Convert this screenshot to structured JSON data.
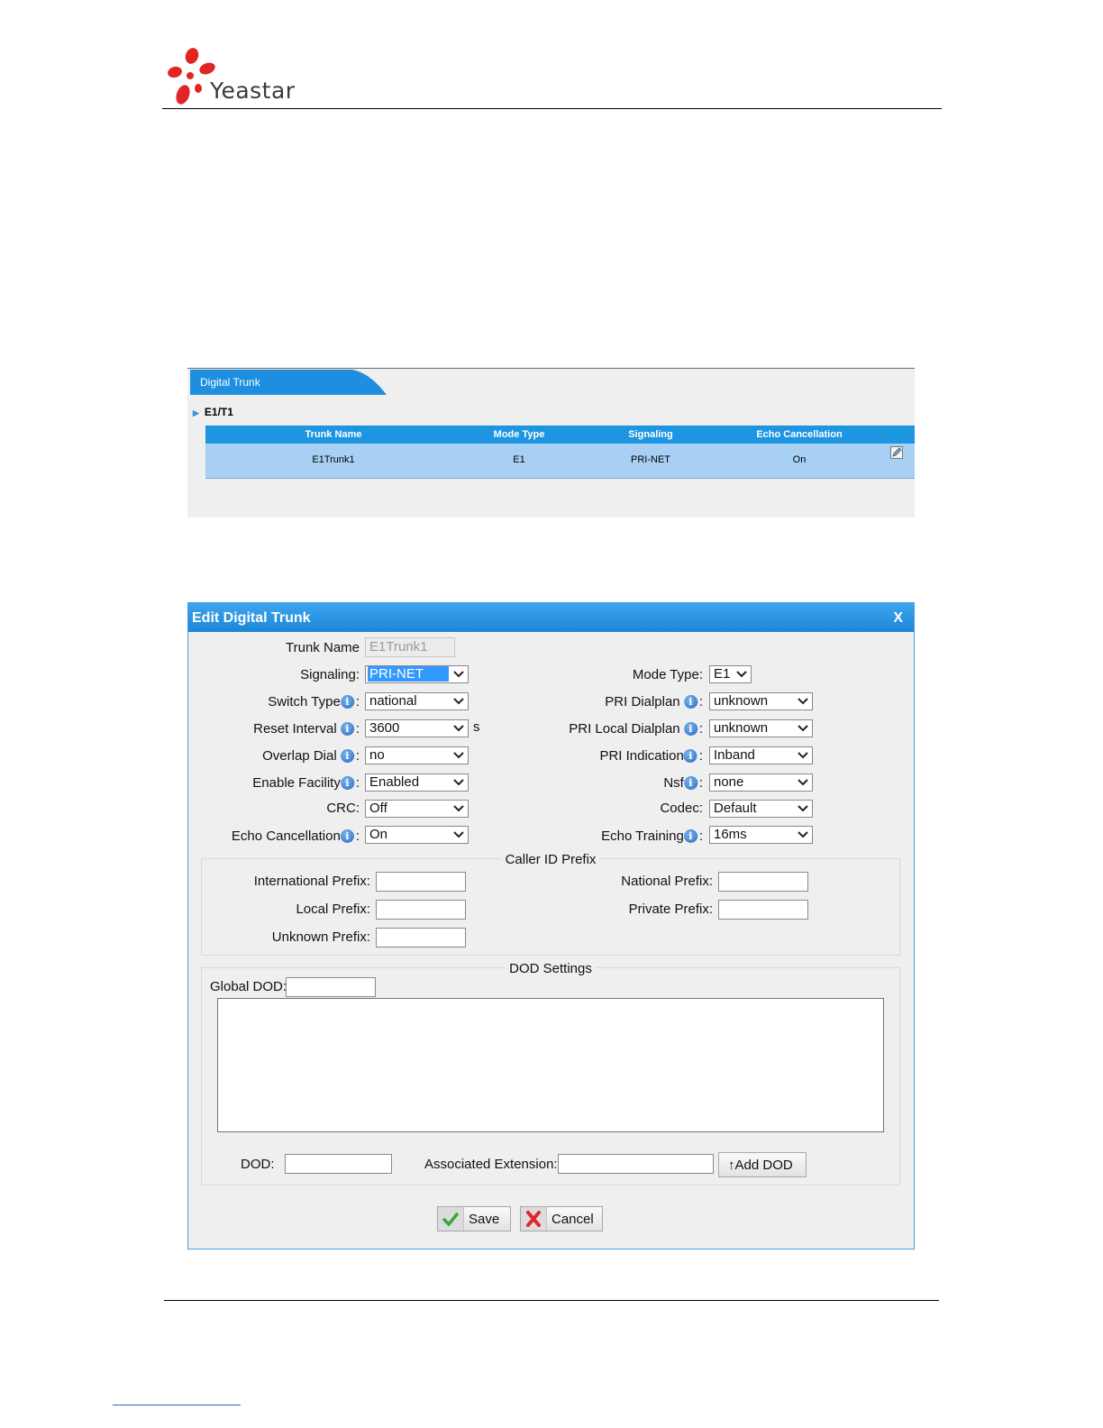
{
  "header": {
    "brand": "Yeastar"
  },
  "digital_trunk": {
    "tab_label": "Digital Trunk",
    "section": "E1/T1",
    "columns": [
      "Trunk Name",
      "Mode Type",
      "Signaling",
      "Echo Cancellation"
    ],
    "rows": [
      {
        "trunk_name": "E1Trunk1",
        "mode_type": "E1",
        "signaling": "PRI-NET",
        "echo_cancellation": "On"
      }
    ]
  },
  "dialog": {
    "title": "Edit Digital Trunk",
    "close": "X",
    "left": {
      "trunk_name_label": "Trunk Name",
      "trunk_name_value": "E1Trunk1",
      "signaling_label": "Signaling:",
      "signaling_value": "PRI-NET",
      "switch_type_label": "Switch Type",
      "switch_type_value": "national",
      "reset_interval_label": "Reset Interval",
      "reset_interval_value": "3600",
      "reset_interval_unit": "s",
      "overlap_dial_label": "Overlap Dial",
      "overlap_dial_value": "no",
      "enable_facility_label": "Enable Facility",
      "enable_facility_value": "Enabled",
      "crc_label": "CRC:",
      "crc_value": "Off",
      "echo_cancellation_label": "Echo Cancellation",
      "echo_cancellation_value": "On"
    },
    "right": {
      "mode_type_label": "Mode Type:",
      "mode_type_value": "E1",
      "pri_dialplan_label": "PRI Dialplan",
      "pri_dialplan_value": "unknown",
      "pri_local_dialplan_label": "PRI Local Dialplan",
      "pri_local_dialplan_value": "unknown",
      "pri_indication_label": "PRI Indication",
      "pri_indication_value": "Inband",
      "nsf_label": "Nsf",
      "nsf_value": "none",
      "codec_label": "Codec:",
      "codec_value": "Default",
      "echo_training_label": "Echo Training",
      "echo_training_value": "16ms"
    },
    "colon": ":",
    "caller_id": {
      "legend": "Caller ID Prefix",
      "international_label": "International Prefix:",
      "national_label": "National Prefix:",
      "local_label": "Local Prefix:",
      "private_label": "Private Prefix:",
      "unknown_label": "Unknown Prefix:"
    },
    "dod": {
      "legend": "DOD Settings",
      "global_label": "Global DOD:",
      "dod_label": "DOD:",
      "assoc_label": "Associated Extension:",
      "add_button": "↑Add DOD"
    },
    "save": "Save",
    "cancel": "Cancel"
  }
}
